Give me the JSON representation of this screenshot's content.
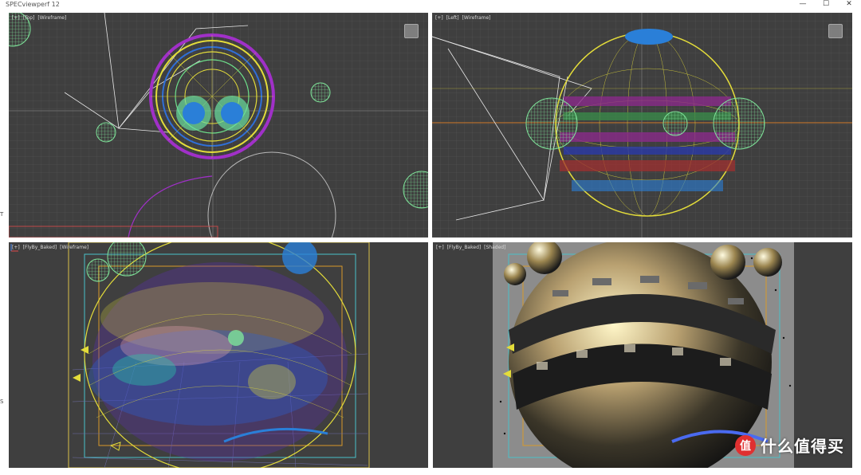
{
  "window": {
    "title": "SPECviewperf 12",
    "minimize_glyph": "—",
    "maximize_glyph": "☐",
    "close_glyph": "✕"
  },
  "edge_marks": [
    "T",
    "S"
  ],
  "viewports": [
    {
      "plus": "[+]",
      "view": "[Top]",
      "mode": "[Wireframe]"
    },
    {
      "plus": "[+]",
      "view": "[Left]",
      "mode": "[Wireframe]"
    },
    {
      "plus": "[+]",
      "view": "[FlyBy_Baked]",
      "mode": "[Wireframe]"
    },
    {
      "plus": "[+]",
      "view": "[FlyBy_Baked]",
      "mode": "[Shaded]"
    }
  ],
  "watermark": {
    "badge": "值",
    "text": "什么值得买"
  },
  "colors": {
    "viewport_bg": "#3f3f3f",
    "grid": "#5a5a5a",
    "wire_yellow": "#e6e04a",
    "wire_green": "#6ee58a",
    "wire_purple": "#8a3ad8",
    "wire_blue": "#2a7fd8",
    "shaded_bg": "#8c8c8c"
  },
  "icons": [
    "navigation-cube-icon",
    "axis-gizmo-icon",
    "minimize-icon",
    "maximize-icon",
    "close-icon"
  ]
}
